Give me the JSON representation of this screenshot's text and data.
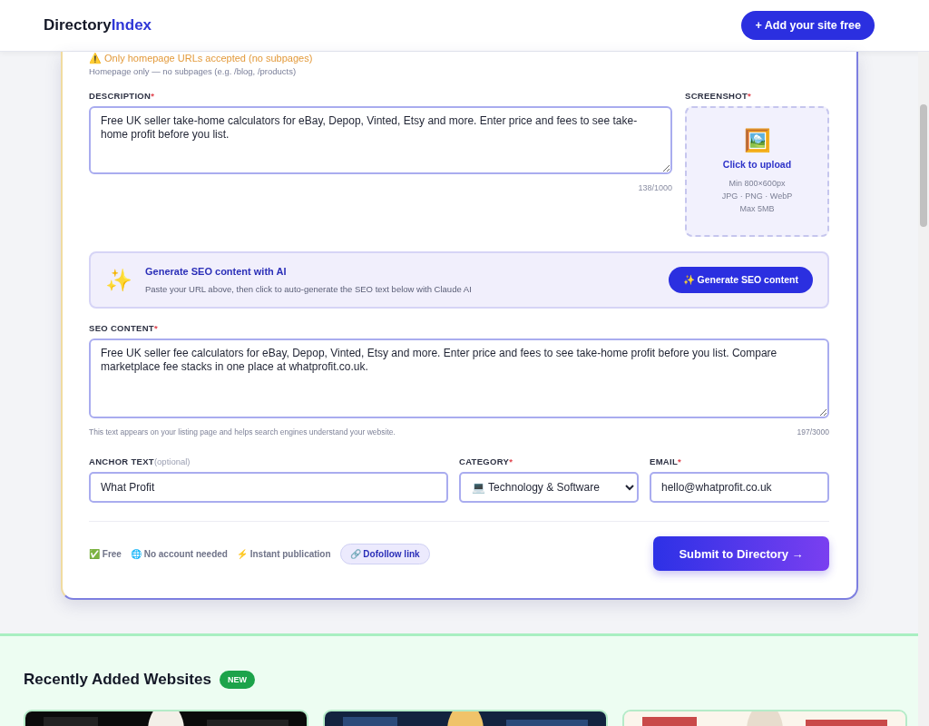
{
  "header": {
    "logo": {
      "part_1": "Directory",
      "part_2": "Index"
    },
    "add_button": "+ Add your site free"
  },
  "url_notes": {
    "warning": "⚠️ Only homepage URLs accepted (no subpages)",
    "hint": "Homepage only — no subpages (e.g. /blog, /products)"
  },
  "description": {
    "label": "DESCRIPTION",
    "required_mark": "*",
    "value": "Free UK seller take-home calculators for eBay, Depop, Vinted, Etsy and more. Enter price and fees to see take-home profit before you list.",
    "counter": "138/1000"
  },
  "screenshot": {
    "label": "SCREENSHOT",
    "required_mark": "*",
    "icon": "🖼️",
    "action": "Click to upload",
    "notes": [
      "Min 800×600px",
      "JPG · PNG · WebP",
      "Max 5MB"
    ]
  },
  "ai_box": {
    "icon": "✨",
    "title": "Generate SEO content with AI",
    "text": "Paste your URL above, then click to auto-generate the SEO text below with Claude AI",
    "button": "✨ Generate SEO content"
  },
  "seo_content": {
    "label": "SEO CONTENT",
    "required_mark": "*",
    "value": "Free UK seller fee calculators for eBay, Depop, Vinted, Etsy and more. Enter price and fees to see take-home profit before you list. Compare marketplace fee stacks in one place at whatprofit.co.uk.",
    "hint": "This text appears on your listing page and helps search engines understand your website.",
    "counter": "197/3000"
  },
  "fields": [
    {
      "kind": "text",
      "label": "ANCHOR TEXT",
      "optional": "(optional)",
      "value": "What Profit"
    },
    {
      "kind": "select",
      "label": "CATEGORY",
      "required_mark": "*",
      "value": "💻 Technology & Software"
    },
    {
      "kind": "text",
      "label": "EMAIL",
      "required_mark": "*",
      "value": "hello@whatprofit.co.uk"
    }
  ],
  "perks": [
    "✅ Free",
    "🌐 No account needed",
    "⚡ Instant publication"
  ],
  "dofollow_badge": "🔗 Dofollow link",
  "submit_button": "Submit to Directory →",
  "recent": {
    "title": "Recently Added Websites",
    "badge": "NEW"
  }
}
